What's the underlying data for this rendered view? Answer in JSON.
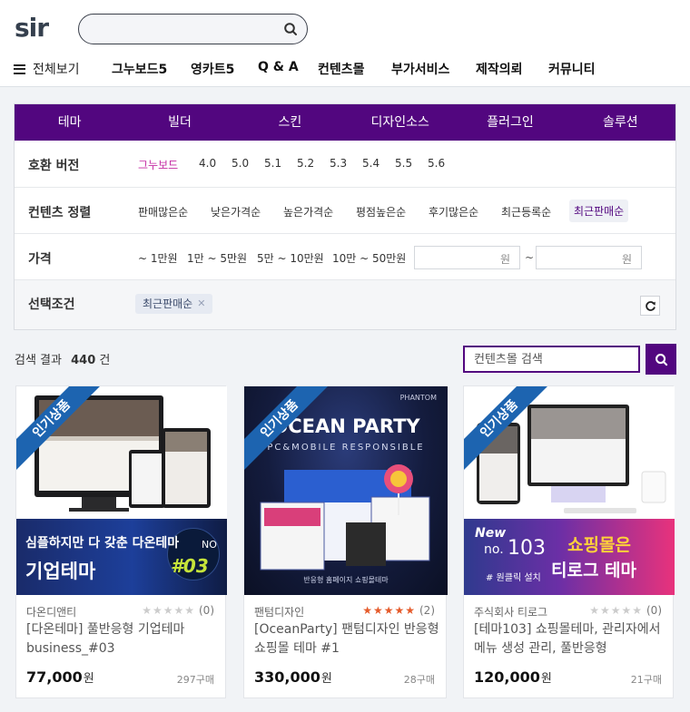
{
  "header": {
    "logo": "sir",
    "search_placeholder": "",
    "nav_all": "전체보기",
    "nav_items": [
      "그누보드5",
      "영카트5",
      "Q & A",
      "컨텐츠몰",
      "부가서비스",
      "제작의뢰",
      "커뮤니티"
    ]
  },
  "filter": {
    "categories": [
      "테마",
      "빌더",
      "스킨",
      "디자인소스",
      "플러그인",
      "솔루션"
    ],
    "version": {
      "label": "호환 버전",
      "options": [
        "그누보드",
        "4.0",
        "5.0",
        "5.1",
        "5.2",
        "5.3",
        "5.4",
        "5.5",
        "5.6"
      ]
    },
    "sort": {
      "label": "컨텐츠 정렬",
      "options": [
        "판매많은순",
        "낮은가격순",
        "높은가격순",
        "평점높은순",
        "후기많은순",
        "최근등록순",
        "최근판매순"
      ]
    },
    "price": {
      "label": "가격",
      "options": [
        "~ 1만원",
        "1만 ~ 5만원",
        "5만 ~ 10만원",
        "10만 ~ 50만원"
      ],
      "unit": "원",
      "tilde": "~"
    },
    "selected": {
      "label": "선택조건",
      "chip": "최근판매순",
      "chip_remove": "✕"
    }
  },
  "results": {
    "label": "검색 결과",
    "count": "440",
    "unit": "건",
    "search_placeholder": "컨텐츠몰 검색"
  },
  "products": [
    {
      "ribbon": "인기상품",
      "banner_line1": "심플하지만 다 갖춘 다온테마",
      "banner_line2": "기업테마",
      "banner_no": "NO",
      "banner_num": "#03",
      "seller": "다온디앤티",
      "stars": "★★★★★",
      "reviews": "(0)",
      "name": "[다온테마] 풀반응형 기업테마 business_#03",
      "price": "77,000",
      "won": "원",
      "sold": "297구매"
    },
    {
      "ribbon": "인기상품",
      "brand": "PHANTOM",
      "banner_title": "OCEAN PARTY",
      "banner_sub": "PC&MOBILE RESPONSIBLE",
      "banner_foot": "반응형 홈페이지 쇼핑몰테마",
      "seller": "팬텀디자인",
      "stars": "★★★★★",
      "reviews": "(2)",
      "name": "[OceanParty] 팬텀디자인 반응형 쇼핑몰 테마 #1",
      "price": "330,000",
      "won": "원",
      "sold": "28구매"
    },
    {
      "ribbon": "인기상품",
      "banner_new": "New",
      "banner_no": "no.",
      "banner_num": "103",
      "banner_sub": "# 원클릭 설치",
      "banner_r1": "쇼핑몰은",
      "banner_r2": "티로그 테마",
      "seller": "주식회사 티로그",
      "stars": "★★★★★",
      "reviews": "(0)",
      "name": "[테마103] 쇼핑몰테마, 관리자에서 메뉴 생성 관리, 풀반응형",
      "price": "120,000",
      "won": "원",
      "sold": "21구매"
    }
  ],
  "colors": {
    "brand_purple": "#52067f",
    "active_pink": "#c42ba3",
    "ribbon_blue": "#1d64b0",
    "star_gold": "#e55b2b"
  }
}
